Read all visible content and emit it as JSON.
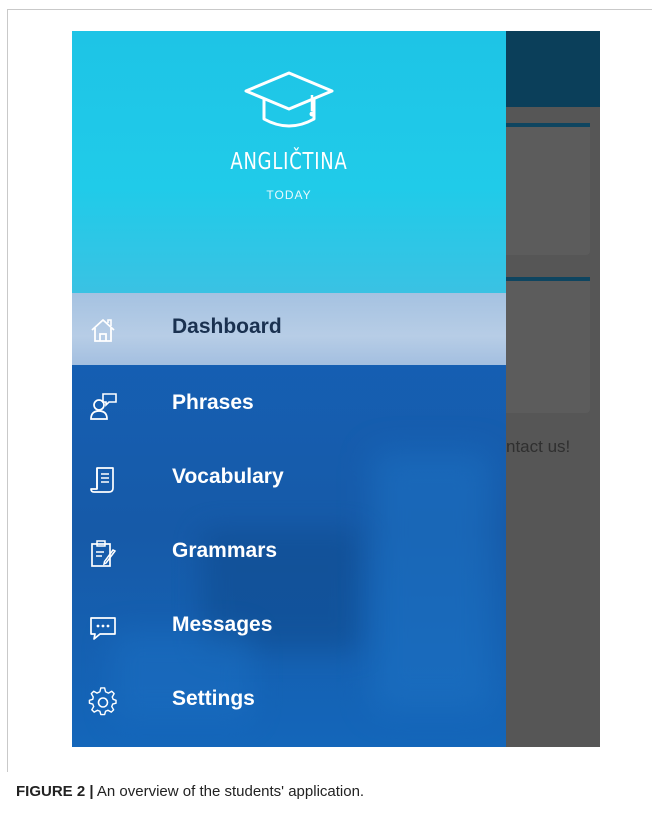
{
  "caption": {
    "label": "FIGURE 2",
    "separator": "|",
    "text": "An overview of the students' application."
  },
  "app": {
    "logo": {
      "title": "ANGLIČTINA",
      "subtitle": "TODAY",
      "icon": "graduation-cap-icon"
    },
    "menu": [
      {
        "label": "Dashboard",
        "icon": "home-icon",
        "active": true
      },
      {
        "label": "Phrases",
        "icon": "speech-person-icon",
        "active": false
      },
      {
        "label": "Vocabulary",
        "icon": "scroll-book-icon",
        "active": false
      },
      {
        "label": "Grammars",
        "icon": "clipboard-edit-icon",
        "active": false
      },
      {
        "label": "Messages",
        "icon": "chat-bubble-icon",
        "active": false
      },
      {
        "label": "Settings",
        "icon": "gear-icon",
        "active": false
      }
    ],
    "background_text": {
      "contact": "ntact us!"
    },
    "colors": {
      "header": "#20cbe9",
      "drawer": "#1560b5",
      "active_item": "#b7cde6",
      "app_bar": "#0b3f5a"
    }
  }
}
